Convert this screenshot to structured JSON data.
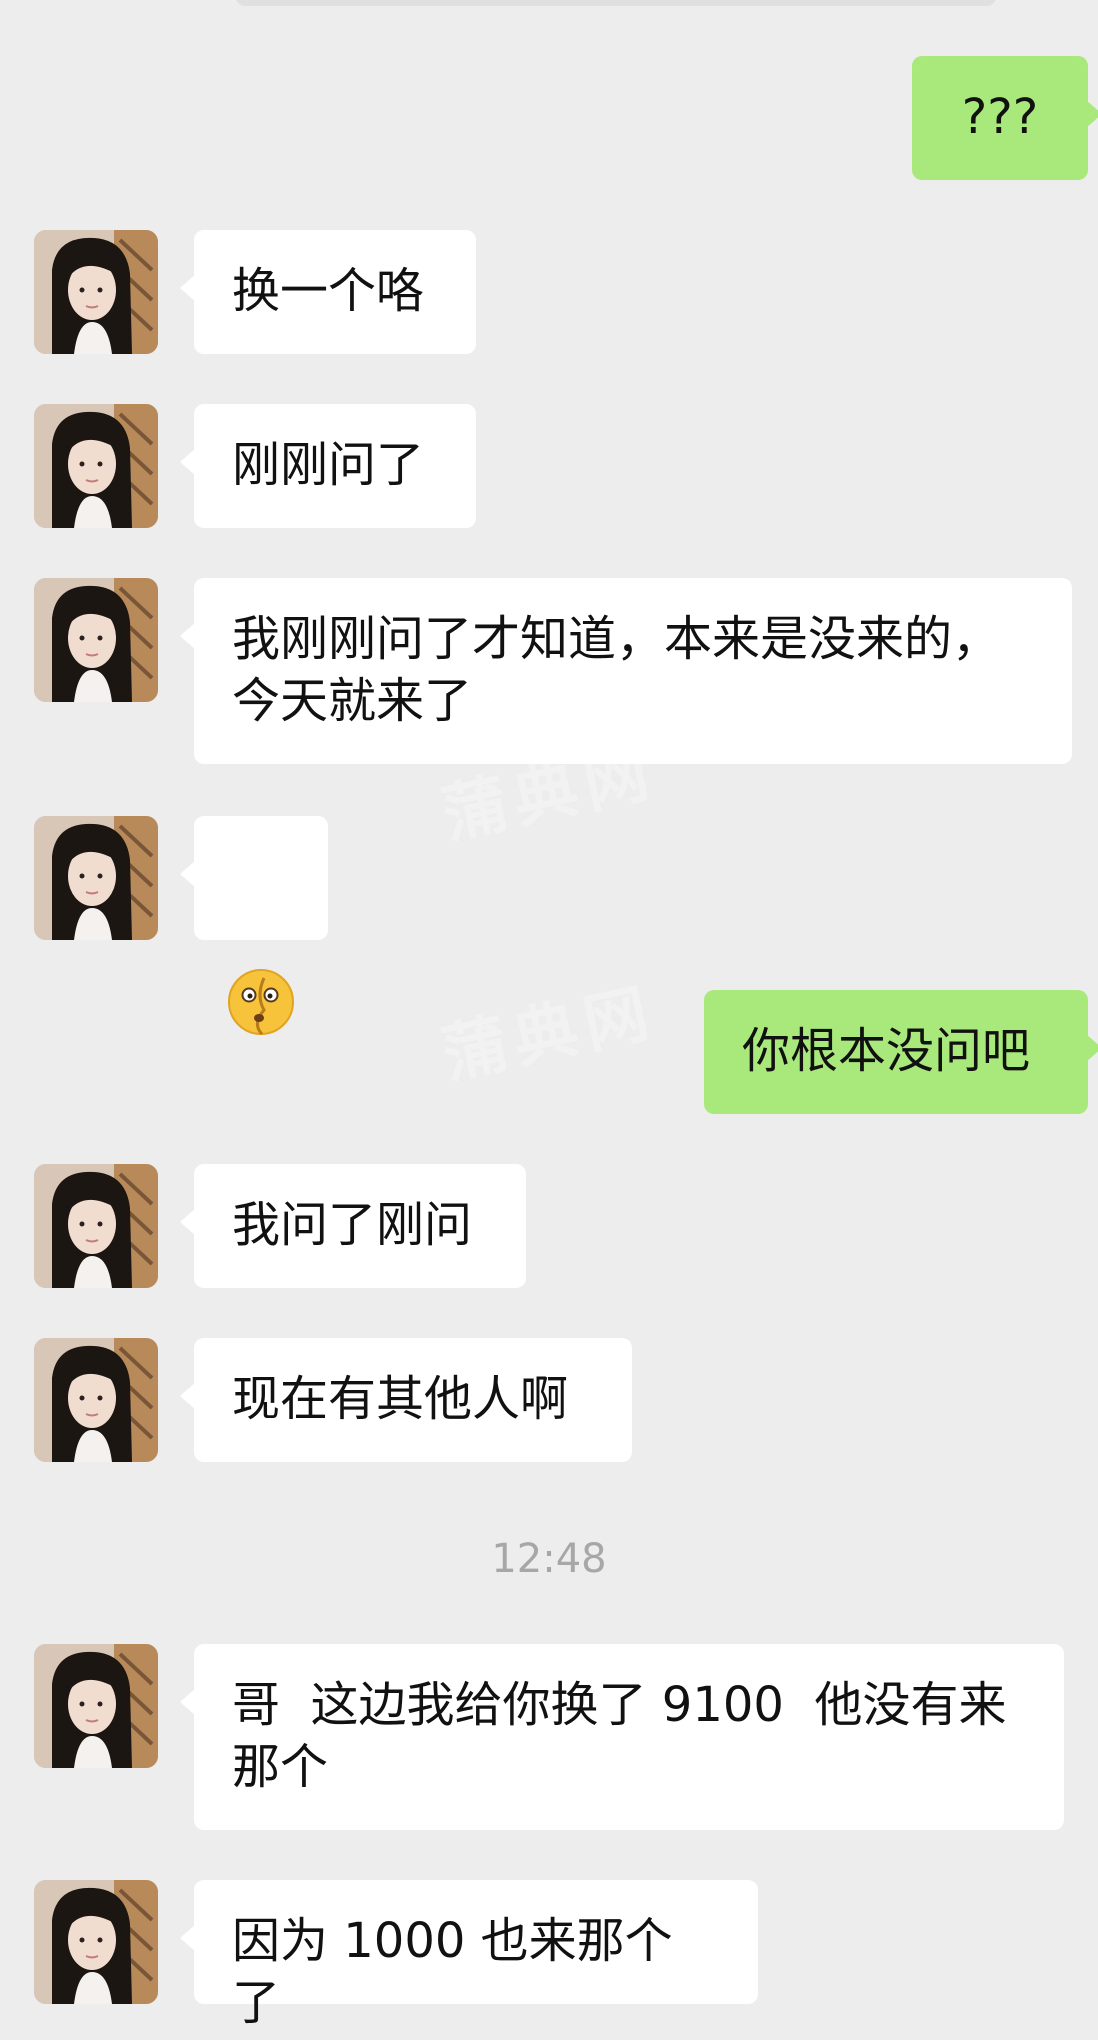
{
  "messages": [
    {
      "side": "right",
      "text": "???"
    },
    {
      "side": "left",
      "text": "换一个咯"
    },
    {
      "side": "left",
      "text": "刚刚问了"
    },
    {
      "side": "left",
      "text": "我刚刚问了才知道，本来是没来的，今天就来了"
    },
    {
      "side": "left",
      "text": "😵‍💫"
    },
    {
      "side": "right",
      "text": "你根本没问吧"
    },
    {
      "side": "left",
      "text": "我问了刚问"
    },
    {
      "side": "left",
      "text": "现在有其他人啊"
    },
    {
      "side": "left",
      "text": "哥  这边我给你换了 9100  他没有来那个"
    },
    {
      "side": "left",
      "text": "因为 1000 也来那个了"
    }
  ],
  "timestamp": "12:48",
  "watermark": "蒲典网",
  "colors": {
    "background": "#ededed",
    "incoming_bubble": "#ffffff",
    "outgoing_bubble": "#a9e97b",
    "timestamp": "#a7a7a7"
  }
}
